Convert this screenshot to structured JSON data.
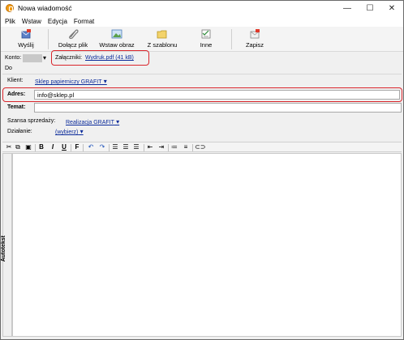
{
  "window": {
    "title": "Nowa wiadomość",
    "min": "—",
    "max": "☐",
    "close": "✕"
  },
  "menu": [
    "Plik",
    "Wstaw",
    "Edycja",
    "Format"
  ],
  "toolbar": {
    "send": "Wyślij",
    "attach": "Dołącz plik",
    "insert_image": "Wstaw obraz",
    "from_template": "Z szablonu",
    "other": "Inne",
    "save": "Zapisz"
  },
  "header": {
    "account_label": "Konto:",
    "attachments_label": "Załączniki:",
    "attachment_file": "Wydruk.pdf (41 kB)",
    "to_label": "Do",
    "client_label": "Klient:",
    "client_value": "Sklep papierniczy GRAFIT",
    "address_label": "Adres:",
    "address_value": "info@sklep.pl",
    "subject_label": "Temat:",
    "subject_value": "",
    "sales_label": "Szansa sprzedaży:",
    "sales_value": "Realizacja GRAFIT",
    "action_label": "Działanie:",
    "action_value": "(wybierz)"
  },
  "editor_toolbar": {
    "bold": "B",
    "italic": "I",
    "underline": "U",
    "font": "F"
  },
  "side_panel": {
    "label": "Autotekst"
  },
  "colors": {
    "highlight": "#d9252b",
    "link": "#0a2a9a"
  }
}
